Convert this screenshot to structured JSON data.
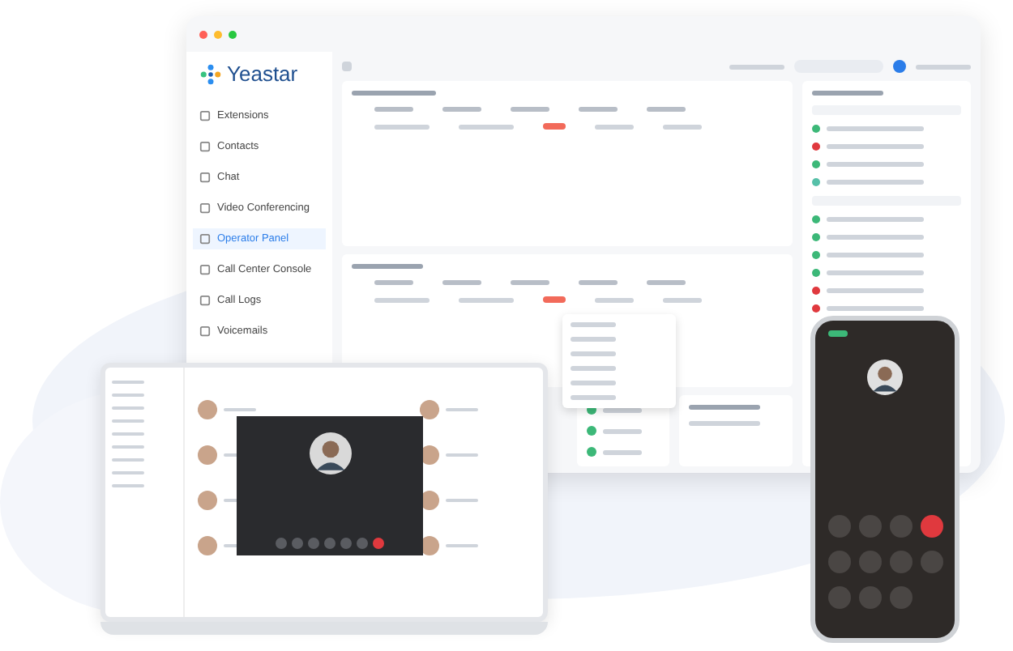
{
  "app": {
    "logo": "Yeastar",
    "nav": [
      {
        "label": "Extensions",
        "selected": false
      },
      {
        "label": "Contacts",
        "selected": false
      },
      {
        "label": "Chat",
        "selected": false
      },
      {
        "label": "Video Conferencing",
        "selected": false
      },
      {
        "label": "Operator Panel",
        "selected": true
      },
      {
        "label": "Call Center Console",
        "selected": false
      },
      {
        "label": "Call Logs",
        "selected": false
      },
      {
        "label": "Voicemails",
        "selected": false
      }
    ]
  },
  "extension_groups": [
    {
      "items": [
        {
          "color": "#3cb878"
        },
        {
          "color": "#e0393e"
        },
        {
          "color": "#3cb878"
        },
        {
          "color": "#56c0a8"
        }
      ]
    },
    {
      "items": [
        {
          "color": "#3cb878"
        },
        {
          "color": "#3cb878"
        },
        {
          "color": "#3cb878"
        },
        {
          "color": "#3cb878"
        },
        {
          "color": "#e0393e"
        },
        {
          "color": "#e0393e"
        }
      ]
    }
  ]
}
